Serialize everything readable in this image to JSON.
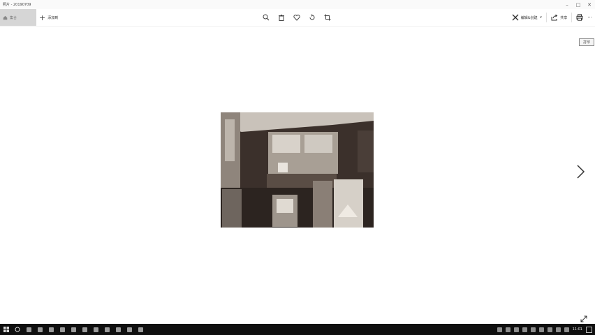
{
  "window": {
    "title": "照片 - 20190709"
  },
  "toolbar": {
    "home_label": "集合",
    "add_label": "添加到",
    "edit_label": "编辑&创建",
    "share_label": "共享",
    "more_label": "···"
  },
  "tooltip": {
    "label": "打印"
  },
  "taskbar": {
    "clock": "11:01"
  },
  "colors": {
    "taskbar": "#0f0f0f",
    "home_tab": "#d6d6d6",
    "background": "#ffffff"
  }
}
